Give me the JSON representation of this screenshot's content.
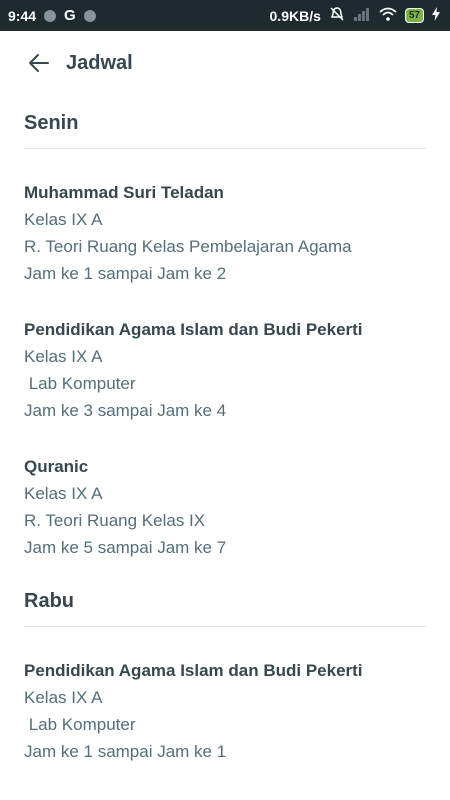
{
  "status_bar": {
    "time": "9:44",
    "g_label": "G",
    "network_speed": "0.9KB/s",
    "battery": "57",
    "icons": [
      "dot-icon",
      "google-icon",
      "dot-icon",
      "mute-icon",
      "signal-icon",
      "wifi-icon",
      "battery-icon",
      "charging-icon"
    ]
  },
  "appbar": {
    "title": "Jadwal",
    "back_icon": "arrow-left-icon"
  },
  "days": [
    {
      "name": "Senin",
      "entries": [
        {
          "subject": "Muhammad Suri Teladan",
          "kelas": "Kelas IX A",
          "ruang": "R. Teori Ruang Kelas Pembelajaran Agama",
          "jam": "Jam ke 1 sampai Jam ke 2"
        },
        {
          "subject": "Pendidikan Agama Islam dan Budi Pekerti",
          "kelas": "Kelas IX A",
          "ruang": " Lab Komputer",
          "jam": "Jam ke 3 sampai Jam ke 4"
        },
        {
          "subject": "Quranic",
          "kelas": "Kelas IX A",
          "ruang": "R. Teori Ruang Kelas IX",
          "jam": "Jam ke 5 sampai Jam ke 7"
        }
      ]
    },
    {
      "name": "Rabu",
      "entries": [
        {
          "subject": "Pendidikan Agama Islam dan Budi Pekerti",
          "kelas": "Kelas IX A",
          "ruang": " Lab Komputer",
          "jam": "Jam ke 1 sampai Jam ke 1"
        }
      ]
    }
  ],
  "colors": {
    "status_bar_bg": "#1f2a2e",
    "text_primary": "#37474f",
    "text_secondary": "#546e7a",
    "divider": "#e3e6e8",
    "battery_fill": "#7cb342"
  }
}
